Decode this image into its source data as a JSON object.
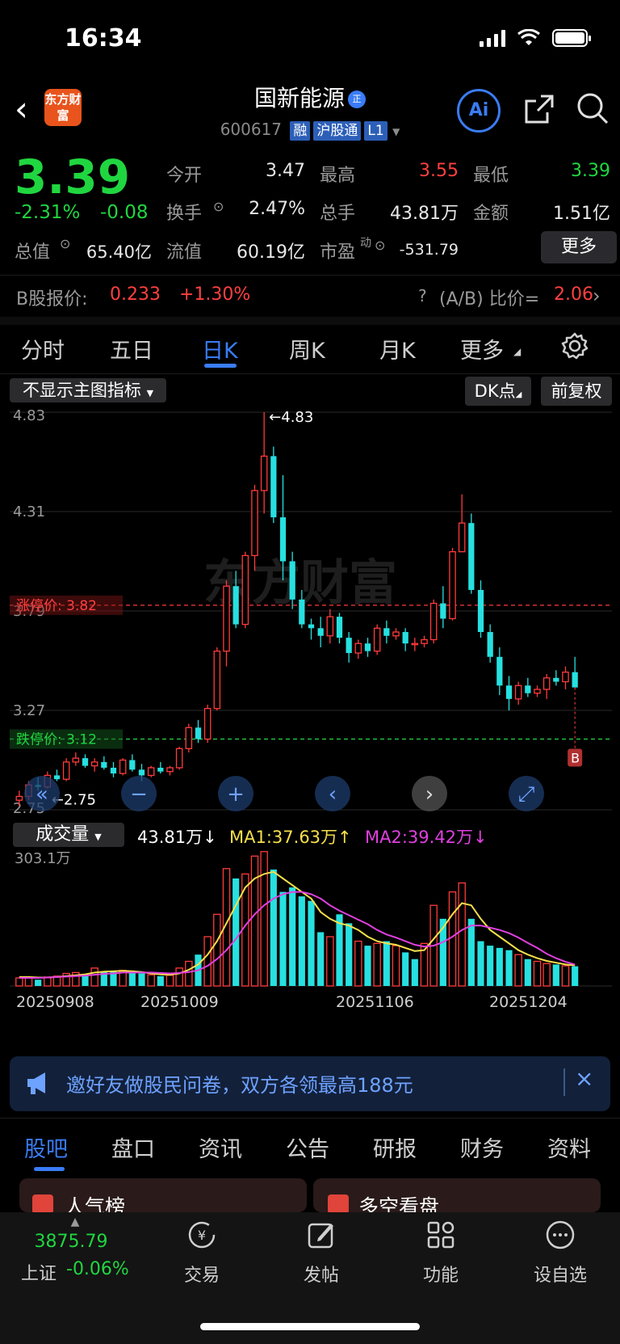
{
  "status": {
    "time": "16:34"
  },
  "header": {
    "logo_text": "东方财富",
    "name": "国新能源",
    "name_badge": "正",
    "code": "600617",
    "tags": [
      "融",
      "沪股通",
      "L1"
    ],
    "ai_label": "Ai"
  },
  "quote": {
    "price": "3.39",
    "change_pct": "-2.31%",
    "change": "-0.08",
    "open_label": "今开",
    "open": "3.47",
    "high_label": "最高",
    "high": "3.55",
    "low_label": "最低",
    "low": "3.39",
    "turnover_label": "换手",
    "turnover": "2.47%",
    "volume_label": "总手",
    "volume": "43.81万",
    "amount_label": "金额",
    "amount": "1.51亿",
    "mktcap_label": "总值",
    "mktcap": "65.40亿",
    "float_label": "流值",
    "float": "60.19亿",
    "pe_label": "市盈",
    "pe_sup": "动",
    "pe": "-531.79",
    "more_label": "更多"
  },
  "bshare": {
    "label": "B股报价:",
    "price": "0.233",
    "change": "+1.30%",
    "ratio_label": "(A/B) 比价=",
    "ratio": "2.06"
  },
  "chart_tabs": {
    "items": [
      "分时",
      "五日",
      "日K",
      "周K",
      "月K",
      "更多"
    ],
    "active": "日K"
  },
  "chart_controls": {
    "indicator": "不显示主图指标",
    "dk": "DK点",
    "adjust": "前复权"
  },
  "chart_data": [
    {
      "type": "candlestick",
      "ylim": [
        2.75,
        4.83
      ],
      "y_ticks": [
        "4.83",
        "4.31",
        "3.79",
        "3.27",
        "2.75"
      ],
      "annotations": [
        "←4.83",
        "←2.75"
      ],
      "limit_up_label": "涨停价:",
      "limit_up": "3.82",
      "limit_down_label": "跌停价:",
      "limit_down": "3.12",
      "buy_marker": "B",
      "candles": [
        [
          2.8,
          2.85,
          2.77,
          2.82
        ],
        [
          2.82,
          2.9,
          2.8,
          2.88
        ],
        [
          2.88,
          2.92,
          2.85,
          2.87
        ],
        [
          2.87,
          2.95,
          2.86,
          2.93
        ],
        [
          2.93,
          2.96,
          2.9,
          2.91
        ],
        [
          2.91,
          3.02,
          2.9,
          3.0
        ],
        [
          3.0,
          3.05,
          2.98,
          3.02
        ],
        [
          3.02,
          3.04,
          2.97,
          2.98
        ],
        [
          2.98,
          3.02,
          2.95,
          3.0
        ],
        [
          3.0,
          3.03,
          2.96,
          2.97
        ],
        [
          2.97,
          3.0,
          2.92,
          2.94
        ],
        [
          2.94,
          3.02,
          2.93,
          3.01
        ],
        [
          3.01,
          3.04,
          2.95,
          2.96
        ],
        [
          2.96,
          2.99,
          2.9,
          2.93
        ],
        [
          2.93,
          2.98,
          2.92,
          2.97
        ],
        [
          2.97,
          3.0,
          2.94,
          2.95
        ],
        [
          2.95,
          2.98,
          2.93,
          2.97
        ],
        [
          2.97,
          3.08,
          2.96,
          3.07
        ],
        [
          3.07,
          3.2,
          3.05,
          3.18
        ],
        [
          3.18,
          3.22,
          3.1,
          3.12
        ],
        [
          3.12,
          3.3,
          3.1,
          3.28
        ],
        [
          3.28,
          3.6,
          3.27,
          3.58
        ],
        [
          3.58,
          3.95,
          3.5,
          3.92
        ],
        [
          3.92,
          4.0,
          3.7,
          3.72
        ],
        [
          3.72,
          4.1,
          3.7,
          4.08
        ],
        [
          4.08,
          4.45,
          4.0,
          4.42
        ],
        [
          4.42,
          4.83,
          4.3,
          4.6
        ],
        [
          4.6,
          4.65,
          4.25,
          4.28
        ],
        [
          4.28,
          4.5,
          3.95,
          4.05
        ],
        [
          4.05,
          4.1,
          3.8,
          3.85
        ],
        [
          3.85,
          3.9,
          3.7,
          3.72
        ],
        [
          3.72,
          3.75,
          3.64,
          3.7
        ],
        [
          3.7,
          3.76,
          3.6,
          3.66
        ],
        [
          3.66,
          3.8,
          3.62,
          3.76
        ],
        [
          3.76,
          3.78,
          3.62,
          3.65
        ],
        [
          3.65,
          3.68,
          3.52,
          3.57
        ],
        [
          3.57,
          3.64,
          3.54,
          3.62
        ],
        [
          3.62,
          3.65,
          3.55,
          3.58
        ],
        [
          3.58,
          3.72,
          3.56,
          3.7
        ],
        [
          3.7,
          3.74,
          3.62,
          3.66
        ],
        [
          3.66,
          3.7,
          3.64,
          3.68
        ],
        [
          3.68,
          3.7,
          3.58,
          3.62
        ],
        [
          3.62,
          3.65,
          3.58,
          3.62
        ],
        [
          3.62,
          3.66,
          3.6,
          3.64
        ],
        [
          3.64,
          3.85,
          3.62,
          3.83
        ],
        [
          3.83,
          3.92,
          3.7,
          3.75
        ],
        [
          3.75,
          4.12,
          3.74,
          4.1
        ],
        [
          4.1,
          4.4,
          4.2,
          4.25
        ],
        [
          4.25,
          4.3,
          3.88,
          3.9
        ],
        [
          3.9,
          3.95,
          3.65,
          3.68
        ],
        [
          3.68,
          3.72,
          3.52,
          3.55
        ],
        [
          3.55,
          3.6,
          3.35,
          3.4
        ],
        [
          3.4,
          3.45,
          3.27,
          3.33
        ],
        [
          3.33,
          3.42,
          3.3,
          3.4
        ],
        [
          3.4,
          3.44,
          3.34,
          3.36
        ],
        [
          3.36,
          3.4,
          3.34,
          3.38
        ],
        [
          3.38,
          3.46,
          3.33,
          3.44
        ],
        [
          3.44,
          3.48,
          3.4,
          3.42
        ],
        [
          3.42,
          3.5,
          3.38,
          3.47
        ],
        [
          3.47,
          3.55,
          3.39,
          3.39
        ]
      ]
    },
    {
      "type": "bar",
      "title": "成交量",
      "latest": "43.81万",
      "ma1_label": "MA1:37.63万",
      "ma1_arrow": "↑",
      "ma2_label": "MA2:39.42万",
      "ma2_arrow": "↓",
      "latest_arrow": "↓",
      "y_max_label": "303.1万",
      "ylim": [
        0,
        303.1
      ],
      "x_labels": [
        "20250908",
        "20251009",
        "20251106",
        "20251204"
      ],
      "values": [
        18,
        20,
        14,
        20,
        22,
        28,
        30,
        25,
        40,
        33,
        32,
        35,
        30,
        28,
        25,
        22,
        24,
        40,
        55,
        70,
        110,
        160,
        262,
        240,
        250,
        290,
        300,
        260,
        210,
        220,
        200,
        190,
        120,
        110,
        160,
        140,
        100,
        90,
        95,
        100,
        90,
        75,
        60,
        95,
        180,
        150,
        210,
        230,
        150,
        100,
        90,
        85,
        80,
        70,
        60,
        55,
        50,
        48,
        45,
        44
      ],
      "ma1": [
        20,
        20,
        19,
        19,
        20,
        22,
        24,
        26,
        30,
        32,
        33,
        34,
        33,
        31,
        28,
        26,
        25,
        28,
        36,
        48,
        70,
        100,
        140,
        180,
        220,
        240,
        250,
        255,
        240,
        225,
        210,
        195,
        165,
        150,
        140,
        135,
        125,
        110,
        100,
        95,
        92,
        85,
        78,
        80,
        105,
        130,
        160,
        185,
        180,
        150,
        125,
        110,
        95,
        80,
        70,
        62,
        56,
        52,
        48,
        46
      ],
      "ma2": [
        18,
        18,
        18,
        19,
        20,
        21,
        22,
        23,
        25,
        27,
        28,
        30,
        30,
        30,
        30,
        29,
        28,
        29,
        31,
        35,
        45,
        60,
        80,
        105,
        135,
        160,
        180,
        195,
        205,
        210,
        210,
        205,
        195,
        180,
        168,
        158,
        148,
        138,
        125,
        115,
        108,
        100,
        92,
        88,
        90,
        98,
        110,
        125,
        135,
        135,
        130,
        125,
        118,
        108,
        96,
        85,
        72,
        62,
        54,
        48
      ],
      "red_flags": [
        1,
        1,
        0,
        1,
        1,
        1,
        1,
        0,
        1,
        0,
        0,
        1,
        0,
        0,
        1,
        0,
        1,
        1,
        1,
        0,
        1,
        1,
        1,
        0,
        1,
        1,
        1,
        0,
        0,
        0,
        0,
        0,
        0,
        1,
        0,
        0,
        1,
        0,
        1,
        0,
        1,
        0,
        0,
        1,
        1,
        0,
        1,
        1,
        0,
        0,
        0,
        0,
        0,
        1,
        0,
        1,
        1,
        0,
        1,
        0
      ]
    }
  ],
  "banner": {
    "text": "邀好友做股民问卷，双方各领最高188元"
  },
  "info_tabs": {
    "items": [
      "股吧",
      "盘口",
      "资讯",
      "公告",
      "研报",
      "财务",
      "资料"
    ],
    "active": "股吧"
  },
  "cards": [
    "人气榜",
    "多空看盘"
  ],
  "bottom_nav": {
    "index_value": "3875.79",
    "index_label": "上证",
    "index_change": "-0.06%",
    "items": [
      "交易",
      "发帖",
      "功能",
      "设自选"
    ]
  }
}
